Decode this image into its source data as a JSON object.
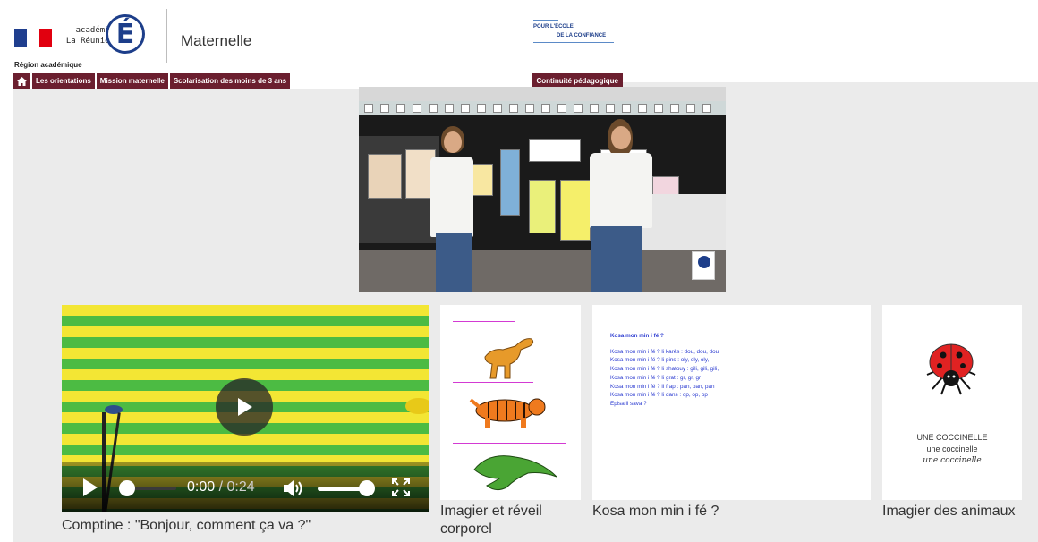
{
  "header": {
    "academie_line1": "académie",
    "academie_line2": "La Réunion",
    "logo_letter": "É",
    "region_label": "Région académique",
    "site_title": "Maternelle",
    "tagline_line1": "POUR L'ÉCOLE",
    "tagline_line2": "DE LA CONFIANCE",
    "colors": {
      "nav": "#6b1f2f",
      "logo": "#1d3e8a",
      "flag_blue": "#1f3e8e",
      "flag_red": "#e1000f"
    }
  },
  "nav": {
    "home_icon": "home-icon",
    "items": [
      "Les orientations",
      "Mission maternelle",
      "Scolarisation des moins de 3 ans"
    ],
    "right_item": "Continuité pédagogique"
  },
  "player": {
    "play_icon": "play-icon",
    "current_time": "0:00",
    "separator": "/",
    "duration": "0:24",
    "volume_icon": "volume-icon",
    "fullscreen_icon": "fullscreen-icon",
    "progress_fraction": 0.0,
    "volume_fraction": 1.0
  },
  "captions": {
    "video2": "Comptine : \"Bonjour, comment ça va ?\"",
    "thumb1": "Imagier et réveil corporel",
    "thumb2": "Kosa mon min i fé ?",
    "thumb3": "Imagier des animaux"
  },
  "poem": {
    "title": "Kosa mon min i fé ?",
    "lines": [
      "Kosa mon min i fé ? li karès : dou, dou, dou",
      "Kosa mon min i fé ? li pins : oly, oly, oly,",
      "Kosa mon min i fé ? li shatouy : gili, gili, gili,",
      "Kosa mon min i fé ? li grat : gr, gr, gr",
      "Kosa mon min i fé ? li frap : pan, pan, pan",
      "Kosa mon min i fé ? li dans : op, op, op",
      "Episa li sava ?"
    ]
  },
  "coccinelle": {
    "line1": "UNE COCCINELLE",
    "line2": "une coccinelle",
    "line3": "une coccinelle"
  }
}
